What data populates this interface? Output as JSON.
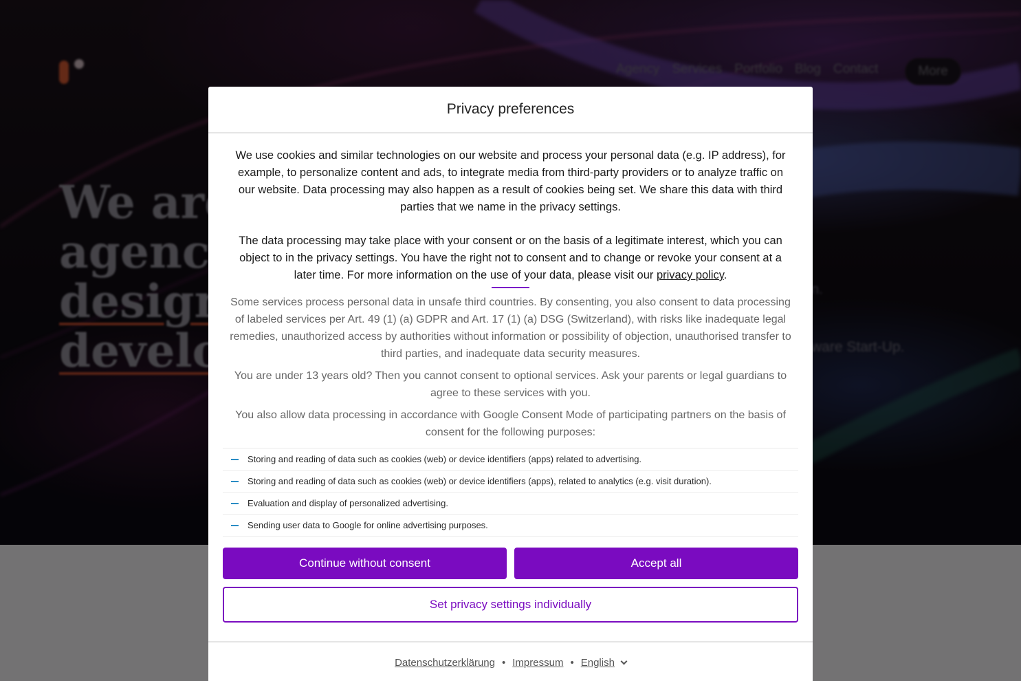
{
  "background": {
    "nav": [
      "Agency",
      "Services",
      "Portfolio",
      "Blog",
      "Contact"
    ],
    "more_label": "More",
    "headline": [
      "We are",
      "agency",
      "design",
      "develop"
    ],
    "side_text_1": "n.",
    "side_text_2": "ware Start-Up."
  },
  "dialog": {
    "title": "Privacy preferences",
    "intro": "We use cookies and similar technologies on our website and process your personal data (e.g. IP address), for example, to personalize content and ads, to integrate media from third-party providers or to analyze traffic on our website. Data processing may also happen as a result of cookies being set. We share this data with third parties that we name in the privacy settings.",
    "legal_text": "The data processing may take place with your consent or on the basis of a legitimate interest, which you can object to in the privacy settings. You have the right not to consent and to change or revoke your consent at a later time. For more information on the use of your data, please visit our ",
    "privacy_policy_link": "privacy policy",
    "legal_end": ".",
    "third_countries": "Some services process personal data in unsafe third countries. By consenting, you also consent to data processing of labeled services per Art. 49 (1) (a) GDPR and Art. 17 (1) (a) DSG (Switzerland), with risks like inadequate legal remedies, unauthorized access by authorities without information or possibility of objection, unauthorised transfer to third parties, and inadequate data security measures.",
    "age_notice": "You are under 13 years old? Then you cannot consent to optional services. Ask your parents or legal guardians to agree to these services with you.",
    "gcm_notice": "You also allow data processing in accordance with Google Consent Mode of participating partners on the basis of consent for the following purposes:",
    "purposes": [
      "Storing and reading of data such as cookies (web) or device identifiers (apps) related to advertising.",
      "Storing and reading of data such as cookies (web) or device identifiers (apps), related to analytics (e.g. visit duration).",
      "Evaluation and display of personalized advertising.",
      "Sending user data to Google for online advertising purposes."
    ],
    "buttons": {
      "continue_without": "Continue without consent",
      "accept_all": "Accept all",
      "individual": "Set privacy settings individually"
    },
    "footer": {
      "privacy_link": "Datenschutzerklärung",
      "imprint_link": "Impressum",
      "language": "English",
      "separator": "•"
    }
  },
  "colors": {
    "accent": "#7a0bc0",
    "purpose_dash": "#2a8cc4"
  }
}
